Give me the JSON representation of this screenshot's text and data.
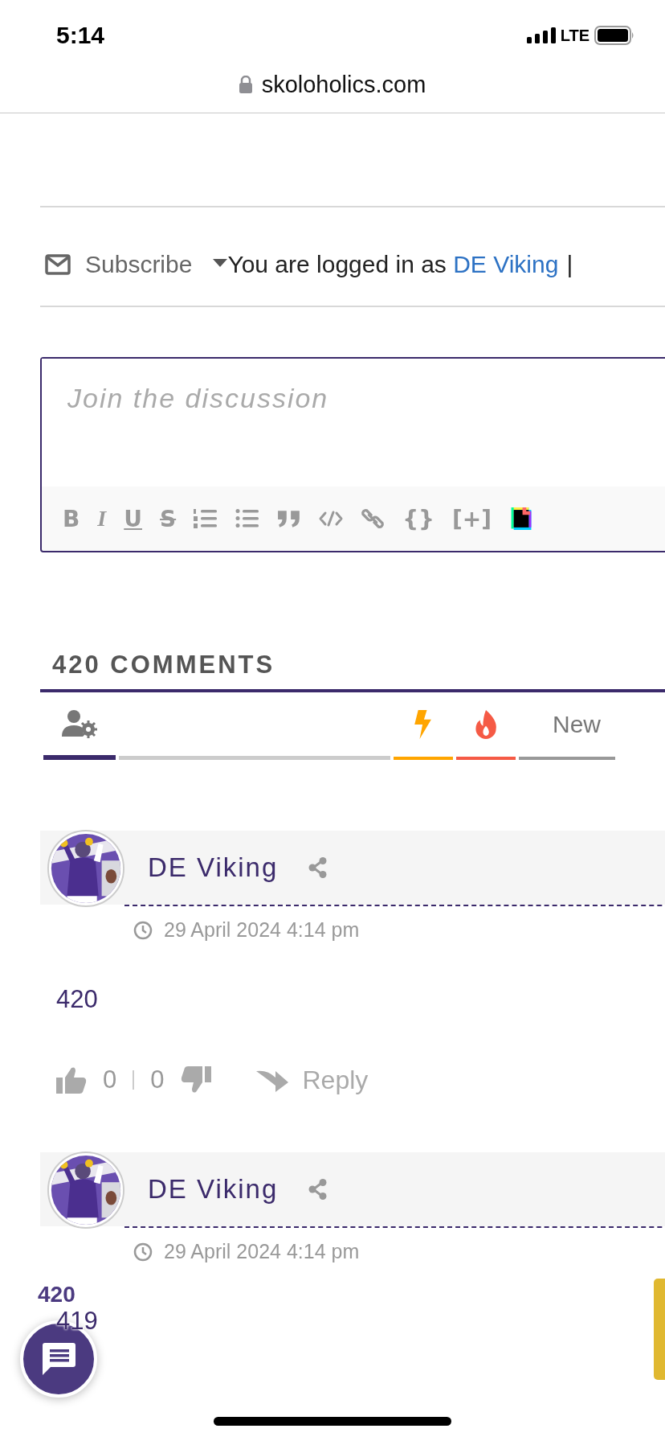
{
  "status_bar": {
    "time": "5:14",
    "network": "LTE"
  },
  "address_bar": {
    "url": "skoloholics.com"
  },
  "subscribe": {
    "label": "Subscribe",
    "logged_in_text": "You are logged in as ",
    "user": "DE Viking",
    "separator": "|"
  },
  "editor": {
    "placeholder": "Join the discussion",
    "toolbar": [
      {
        "kind": "glyph",
        "label": "B"
      },
      {
        "kind": "glyph",
        "label": "I"
      },
      {
        "kind": "glyph",
        "label": "U"
      },
      {
        "kind": "glyph",
        "label": "S"
      },
      {
        "kind": "icon"
      },
      {
        "kind": "icon"
      },
      {
        "kind": "icon"
      },
      {
        "kind": "icon"
      },
      {
        "kind": "icon"
      },
      {
        "kind": "glyph",
        "label": "{}"
      },
      {
        "kind": "glyph",
        "label": "[+]"
      },
      {
        "kind": "icon"
      }
    ]
  },
  "comments_header": "420 COMMENTS",
  "sort_tabs": [
    {
      "kind": "icon",
      "selected": true,
      "color": "#3b2a6b"
    },
    {
      "kind": "icon",
      "selected": false,
      "color": "#ffa500"
    },
    {
      "kind": "icon",
      "selected": false,
      "color": "#f55a45"
    },
    {
      "kind": "text",
      "label": "New",
      "selected": false,
      "color": "#999999"
    }
  ],
  "comments": [
    {
      "author": "DE Viking",
      "date": "29 April 2024 4:14 pm",
      "text": "420",
      "likes": "0",
      "dislikes": "0",
      "reply": "Reply"
    },
    {
      "author": "DE Viking",
      "date": "29 April 2024 4:14 pm",
      "text": "419"
    }
  ],
  "floating_count": "420"
}
